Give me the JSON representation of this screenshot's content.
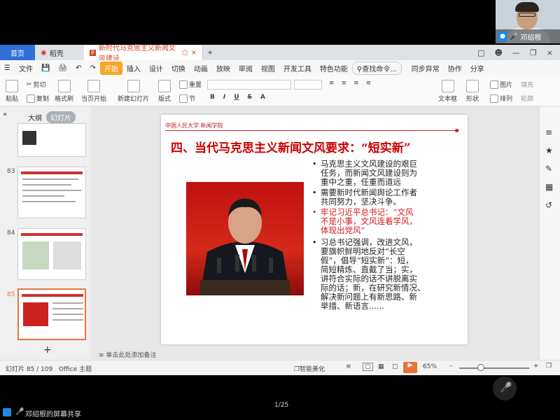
{
  "webcam": {
    "name": "邓绍根"
  },
  "tabs": {
    "home": "首页",
    "daoke": "稻壳",
    "doc": "新时代马克思主义新闻文风建设"
  },
  "menu": [
    "文件",
    "开始",
    "插入",
    "设计",
    "切换",
    "动画",
    "放映",
    "审阅",
    "视图",
    "开发工具",
    "特色功能"
  ],
  "menu_active": "开始",
  "search": "查找命令...",
  "menu_right": [
    "同步异常",
    "协作",
    "分享"
  ],
  "ribbon": {
    "paste": "粘贴",
    "cut": "剪切",
    "copy": "复制",
    "format_painter": "格式刷",
    "from_start": "当页开始",
    "new_slide": "新建幻灯片",
    "layout": "版式",
    "section": "节",
    "reset": "重置",
    "textbox": "文本框",
    "shape": "形状",
    "picture": "图片",
    "arrange": "排列",
    "fill": "填充",
    "outline": "轮廓"
  },
  "panel": {
    "outline": "大纲",
    "slides": "幻灯片"
  },
  "thumbs": [
    "83",
    "84",
    "85"
  ],
  "slide": {
    "logo": "中国人民大学 新闻学院",
    "title": "四、当代马克思主义新闻文风要求：“短实新”",
    "bullets": [
      {
        "lines": [
          "马克思主义文风建设的艰巨",
          "任务，而新闻文风建设则为",
          "重中之重，任重而道远"
        ],
        "red": false
      },
      {
        "lines": [
          "需要新时代新闻舆论工作者",
          "共同努力，坚决斗争。"
        ],
        "red": false
      },
      {
        "lines": [
          "牢记习近平总书记：“文风",
          "不是小事，文风连着学风，",
          "体现出党风”"
        ],
        "red": true
      },
      {
        "lines": [
          "习总书记强调，改进文风，",
          "要旗帜鲜明地反对“长空",
          "假”，倡导“短实新”：短，",
          "简短精炼、直截了当；实，",
          "讲符合实际的话不讲脱离实",
          "际的话；新，在研究新情况、",
          "解决新问题上有新思路、新",
          "举措、新语言......"
        ],
        "red": false
      }
    ]
  },
  "notes": "单击此处添加备注",
  "status": {
    "slide_count": "幻灯片 85 / 109",
    "theme": "Office 主题",
    "beautify": "智能美化",
    "zoom": "65%"
  },
  "bottom": {
    "share": "邓绍根的屏幕共享",
    "page": "1/25"
  }
}
